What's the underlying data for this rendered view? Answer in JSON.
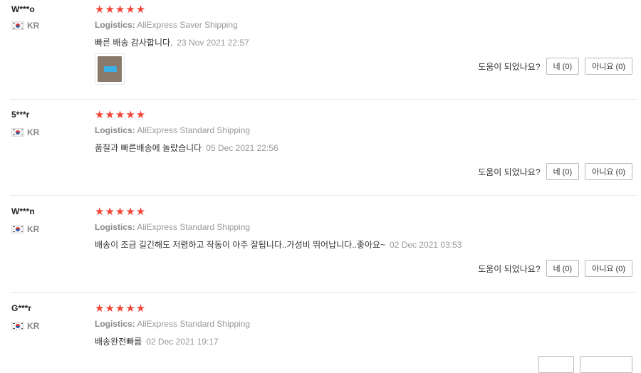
{
  "reviews": [
    {
      "user": "W***o",
      "country": "KR",
      "stars": "★★★★★",
      "logistics_label": "Logistics:",
      "logistics_value": "AliExpress Saver Shipping",
      "text": "빠른 배송 감사합니다.",
      "date": "23 Nov 2021 22:57",
      "has_image": true,
      "helpful_question": "도움이 되었나요?",
      "yes_label": "네 (0)",
      "no_label": "아니요 (0)"
    },
    {
      "user": "5***r",
      "country": "KR",
      "stars": "★★★★★",
      "logistics_label": "Logistics:",
      "logistics_value": "AliExpress Standard Shipping",
      "text": "품질과 빠른배송에 놀랐습니다",
      "date": "05 Dec 2021 22:56",
      "has_image": false,
      "helpful_question": "도움이 되었나요?",
      "yes_label": "네 (0)",
      "no_label": "아니요 (0)"
    },
    {
      "user": "W***n",
      "country": "KR",
      "stars": "★★★★★",
      "logistics_label": "Logistics:",
      "logistics_value": "AliExpress Standard Shipping",
      "text": "배송이 조금 길긴해도 저렴하고 작동이 아주 잘됩니다..가성비 뛰어납니다..좋아요~",
      "date": "02 Dec 2021 03:53",
      "has_image": false,
      "helpful_question": "도움이 되었나요?",
      "yes_label": "네 (0)",
      "no_label": "아니요 (0)"
    },
    {
      "user": "G***r",
      "country": "KR",
      "stars": "★★★★★",
      "logistics_label": "Logistics:",
      "logistics_value": "AliExpress Standard Shipping",
      "text": "배송완전빠름",
      "date": "02 Dec 2021 19:17",
      "has_image": false,
      "helpful_question": "",
      "yes_label": "",
      "no_label": ""
    }
  ],
  "colors": {
    "star": "#f44336",
    "divider": "#e8e8e8",
    "muted_text": "#999999"
  }
}
